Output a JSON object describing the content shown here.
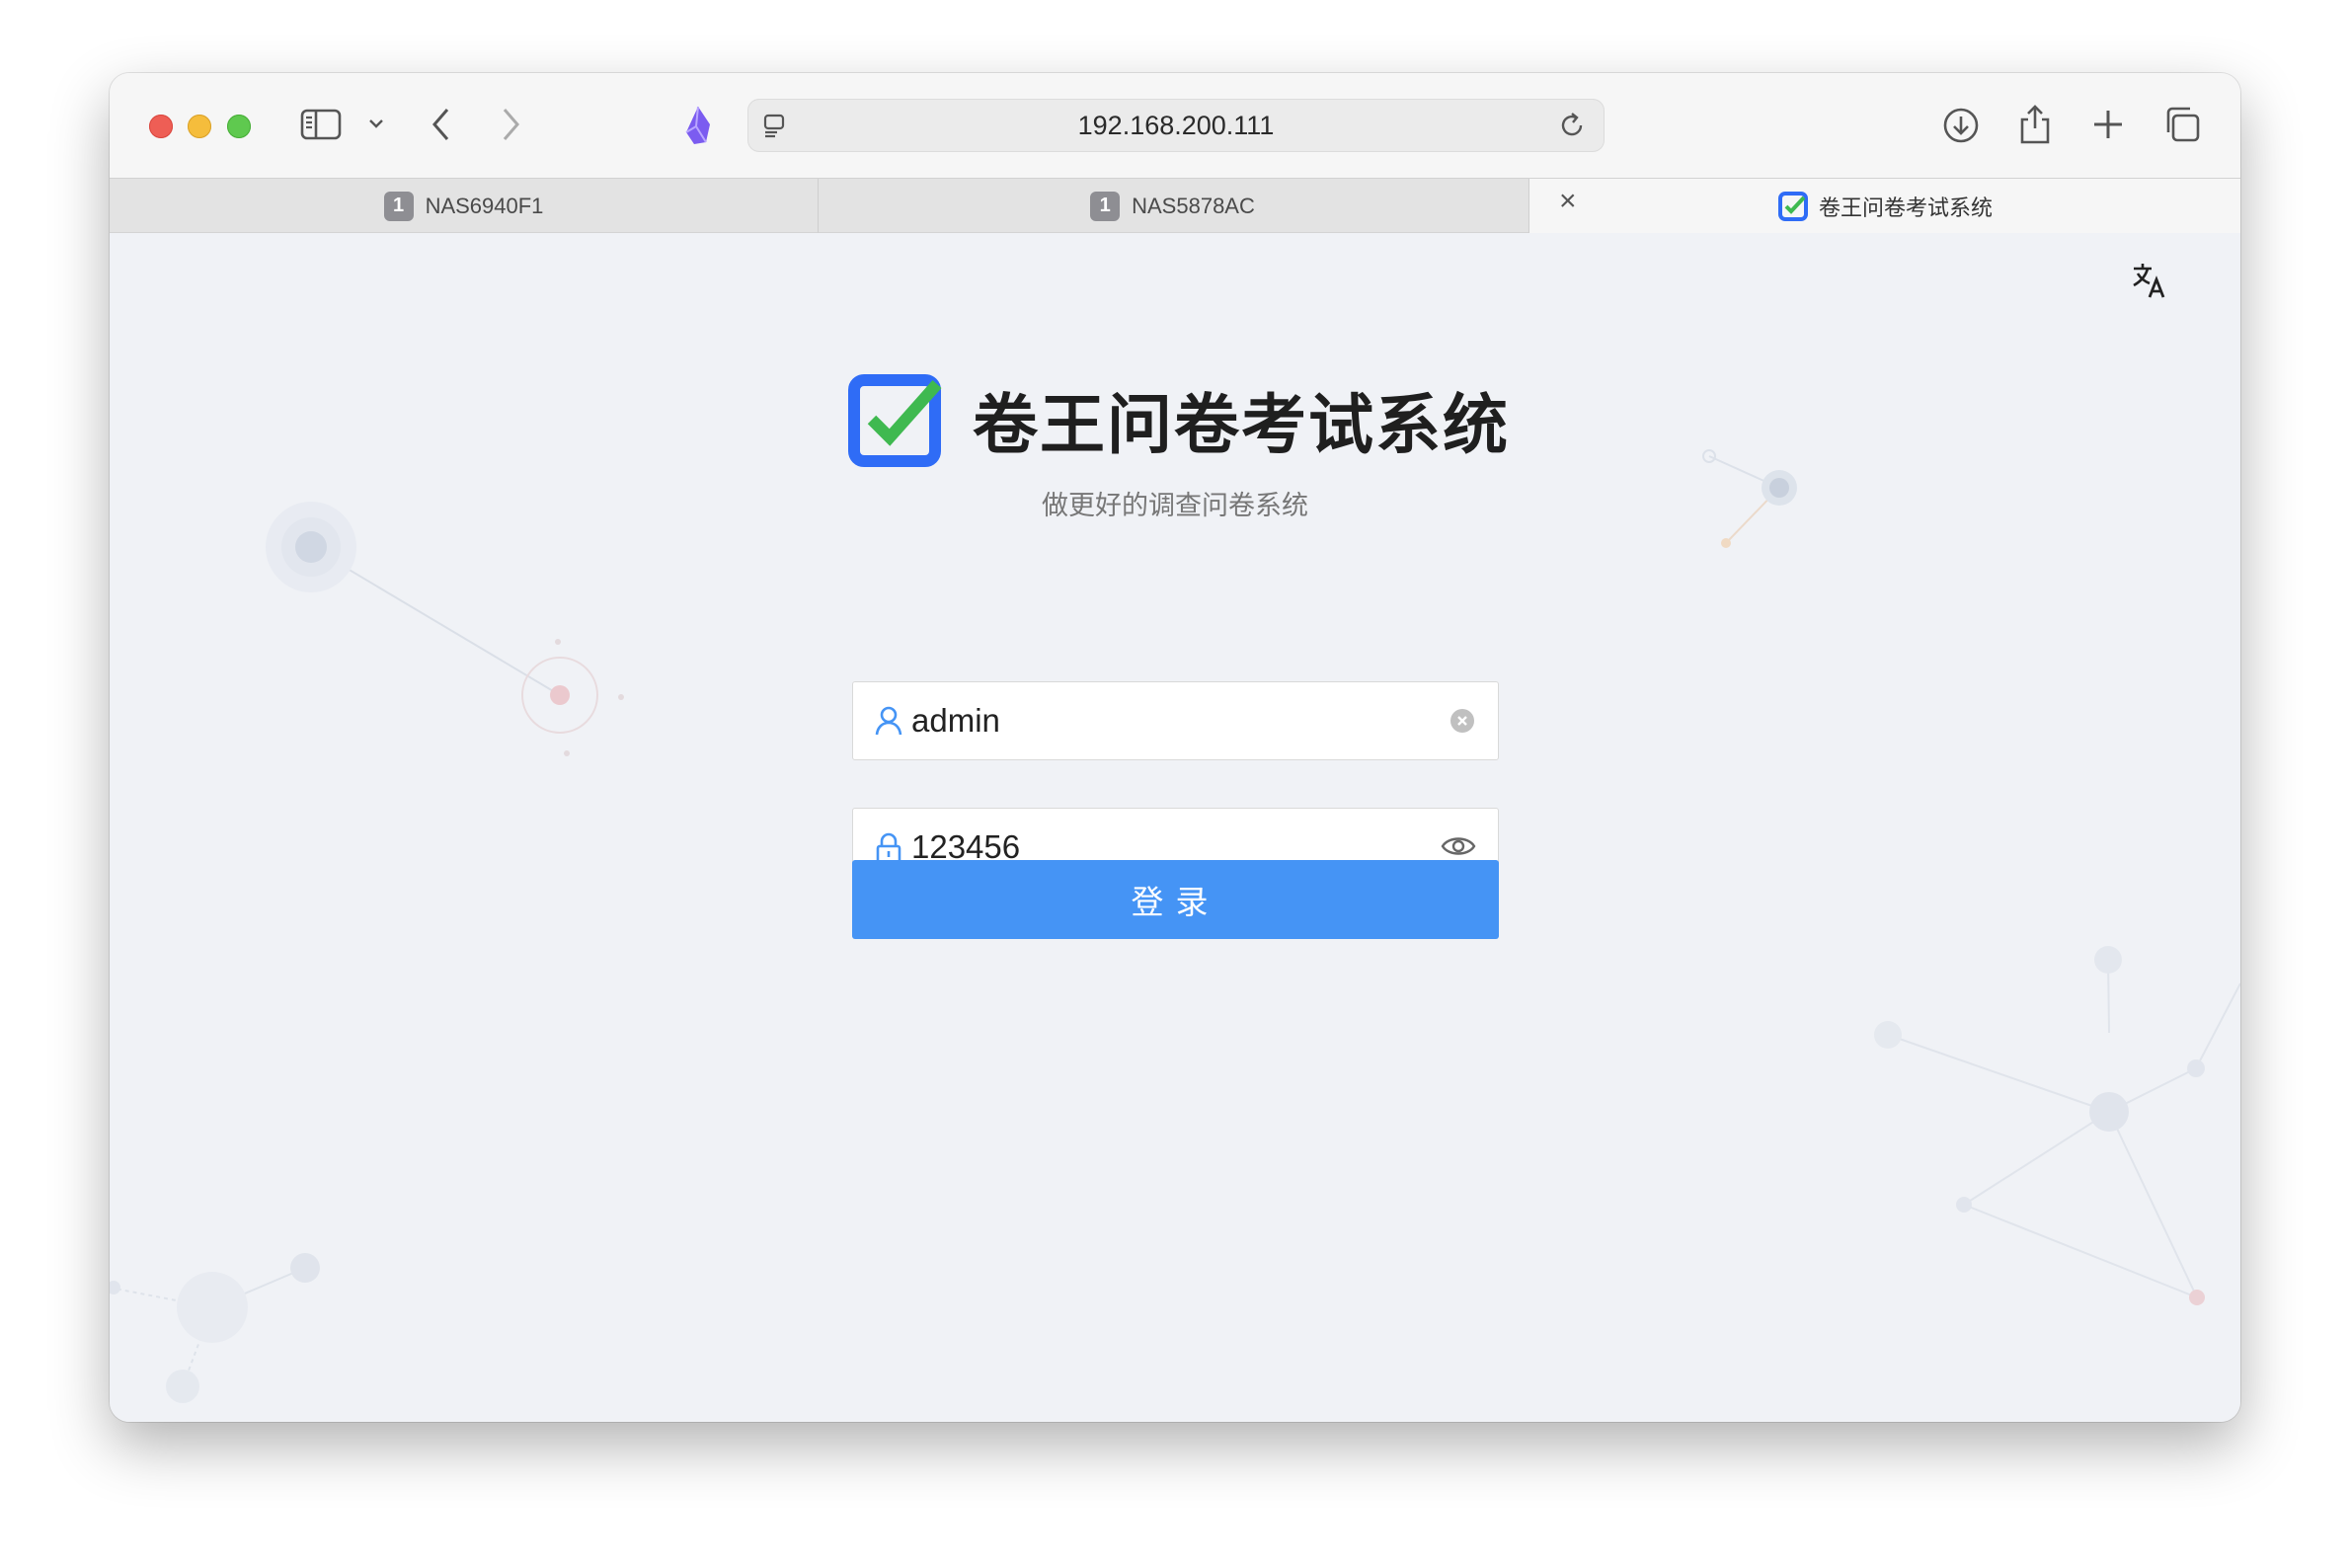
{
  "browser": {
    "url": "192.168.200.111",
    "tabs": [
      {
        "badge": "1",
        "title": "NAS6940F1",
        "active": false
      },
      {
        "badge": "1",
        "title": "NAS5878AC",
        "active": false
      },
      {
        "title": "卷王问卷考试系统",
        "active": true,
        "close_glyph": "×"
      }
    ]
  },
  "page": {
    "title": "卷王问卷考试系统",
    "subtitle": "做更好的调查问卷系统",
    "username": {
      "value": "admin",
      "icon": "user-icon",
      "action_icon": "clear-icon"
    },
    "password": {
      "value": "123456",
      "icon": "lock-icon",
      "action_icon": "eye-icon"
    },
    "login_label": "登录",
    "translate_icon": "translate-icon"
  },
  "colors": {
    "primary": "#4594f5",
    "logo_blue": "#2f6cf6",
    "logo_check": "#3fb950",
    "background": "#f0f2f6"
  }
}
